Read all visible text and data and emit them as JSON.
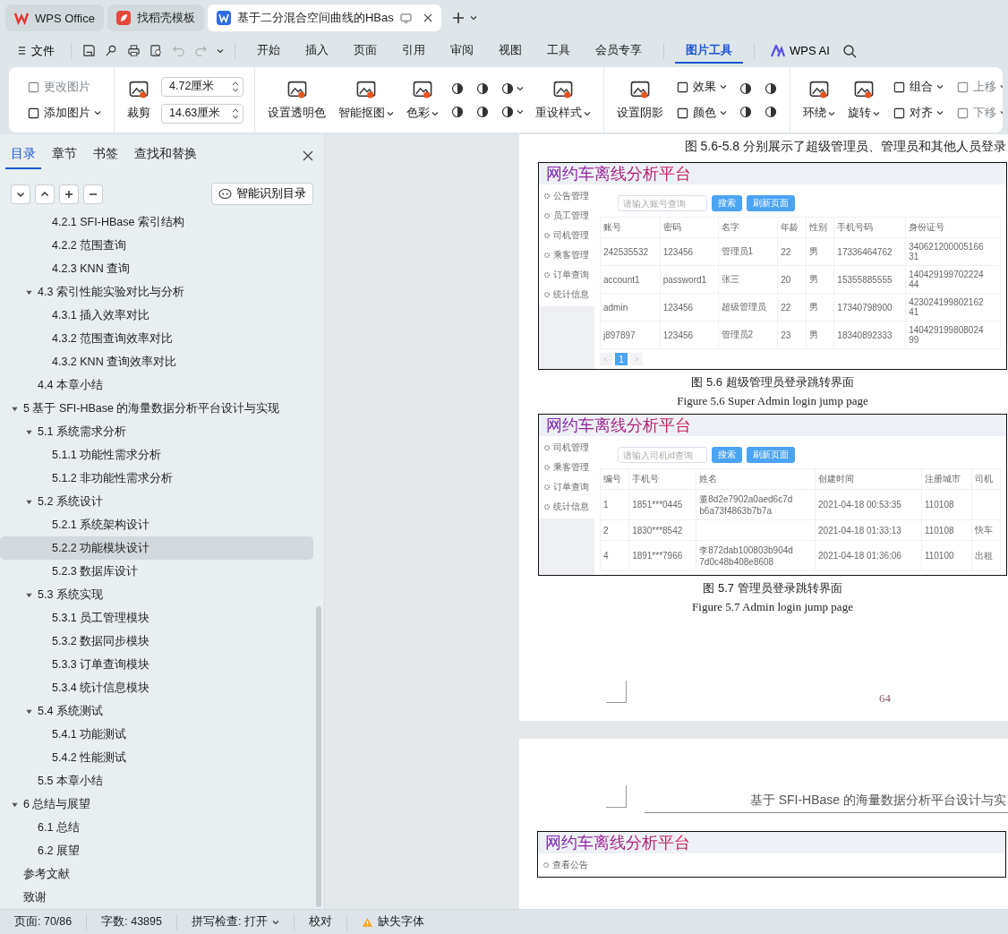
{
  "tabs": [
    {
      "kind": "home",
      "label": "WPS Office",
      "selected": false
    },
    {
      "kind": "template",
      "label": "找稻壳模板",
      "selected": false
    },
    {
      "kind": "document",
      "label": "基于二分混合空间曲线的HBas",
      "selected": true
    }
  ],
  "menu": {
    "file": "文件",
    "items": [
      {
        "label": "开始",
        "selected": false
      },
      {
        "label": "插入",
        "selected": false
      },
      {
        "label": "页面",
        "selected": false
      },
      {
        "label": "引用",
        "selected": false
      },
      {
        "label": "审阅",
        "selected": false
      },
      {
        "label": "视图",
        "selected": false
      },
      {
        "label": "工具",
        "selected": false
      },
      {
        "label": "会员专享",
        "selected": false
      },
      {
        "label": "图片工具",
        "selected": true
      }
    ],
    "ai": "WPS AI"
  },
  "ribbon": {
    "groups": [
      {
        "cols": [
          {
            "kind": "stack",
            "items": [
              {
                "kind": "small",
                "label": "更改图片",
                "dropdown": false,
                "disabled": true
              },
              {
                "kind": "small",
                "label": "添加图片",
                "dropdown": true,
                "disabled": false
              }
            ]
          }
        ]
      },
      {
        "cols": [
          {
            "kind": "big",
            "label": "裁剪",
            "dropdown": false
          },
          {
            "kind": "stack",
            "items": [
              {
                "kind": "field",
                "value": "4.72厘米"
              },
              {
                "kind": "field",
                "value": "14.63厘米"
              }
            ]
          }
        ]
      },
      {
        "cols": [
          {
            "kind": "big",
            "label": "设置透明色",
            "dropdown": false
          },
          {
            "kind": "big",
            "label": "智能抠图",
            "dropdown": true
          },
          {
            "kind": "big",
            "label": "色彩",
            "dropdown": true
          },
          {
            "kind": "stack",
            "items": [
              {
                "kind": "icon",
                "dropdown": false
              },
              {
                "kind": "icon",
                "dropdown": false
              }
            ]
          },
          {
            "kind": "stack",
            "items": [
              {
                "kind": "icon",
                "dropdown": false
              },
              {
                "kind": "icon",
                "dropdown": false
              }
            ]
          },
          {
            "kind": "stack",
            "items": [
              {
                "kind": "icon",
                "dropdown": true
              },
              {
                "kind": "icon",
                "dropdown": true
              }
            ]
          },
          {
            "kind": "big",
            "label": "重设样式",
            "dropdown": true
          }
        ]
      },
      {
        "cols": [
          {
            "kind": "big",
            "label": "设置阴影",
            "dropdown": false
          },
          {
            "kind": "stack",
            "items": [
              {
                "kind": "small",
                "label": "效果",
                "dropdown": true,
                "disabled": false
              },
              {
                "kind": "small",
                "label": "颜色",
                "dropdown": true,
                "disabled": false
              }
            ]
          },
          {
            "kind": "stack",
            "items": [
              {
                "kind": "icon",
                "dropdown": false
              },
              {
                "kind": "icon",
                "dropdown": false
              }
            ]
          },
          {
            "kind": "stack",
            "items": [
              {
                "kind": "icon",
                "dropdown": false
              },
              {
                "kind": "icon",
                "dropdown": false
              }
            ]
          }
        ]
      },
      {
        "cols": [
          {
            "kind": "big",
            "label": "环绕",
            "dropdown": true
          },
          {
            "kind": "big",
            "label": "旋转",
            "dropdown": true
          },
          {
            "kind": "stack",
            "items": [
              {
                "kind": "small",
                "label": "组合",
                "dropdown": true,
                "disabled": false
              },
              {
                "kind": "small",
                "label": "对齐",
                "dropdown": true,
                "disabled": false
              }
            ]
          },
          {
            "kind": "stack",
            "items": [
              {
                "kind": "small",
                "label": "上移",
                "dropdown": true,
                "disabled": true
              },
              {
                "kind": "small",
                "label": "下移",
                "dropdown": true,
                "disabled": true
              }
            ]
          }
        ]
      }
    ]
  },
  "nav": {
    "tabs": [
      {
        "label": "目录",
        "selected": true
      },
      {
        "label": "章节",
        "selected": false
      },
      {
        "label": "书签",
        "selected": false
      },
      {
        "label": "查找和替换",
        "selected": false
      }
    ],
    "smart_button": "智能识别目录",
    "toc": [
      {
        "children": [
          {
            "children": [
              {
                "label": "4.2.1 SFI-HBase 索引结构",
                "selected": false
              },
              {
                "label": "4.2.2 范围查询",
                "selected": false
              },
              {
                "label": "4.2.3 KNN 查询",
                "selected": false
              }
            ]
          },
          {
            "label": "4.3 索引性能实验对比与分析",
            "selected": false,
            "expanded": true,
            "children": [
              {
                "label": "4.3.1 插入效率对比",
                "selected": false
              },
              {
                "label": "4.3.2 范围查询效率对比",
                "selected": false
              },
              {
                "label": "4.3.2 KNN 查询效率对比",
                "selected": false
              }
            ]
          },
          {
            "label": "4.4 本章小结",
            "selected": false
          }
        ]
      },
      {
        "label": "5 基于 SFI-HBase 的海量数据分析平台设计与实现",
        "selected": false,
        "expanded": true,
        "children": [
          {
            "label": "5.1 系统需求分析",
            "selected": false,
            "expanded": true,
            "children": [
              {
                "label": "5.1.1 功能性需求分析",
                "selected": false
              },
              {
                "label": "5.1.2 非功能性需求分析",
                "selected": false
              }
            ]
          },
          {
            "label": "5.2 系统设计",
            "selected": false,
            "expanded": true,
            "children": [
              {
                "label": "5.2.1 系统架构设计",
                "selected": false
              },
              {
                "label": "5.2.2 功能模块设计",
                "selected": true
              },
              {
                "label": "5.2.3 数据库设计",
                "selected": false
              }
            ]
          },
          {
            "label": "5.3 系统实现",
            "selected": false,
            "expanded": true,
            "children": [
              {
                "label": "5.3.1 员工管理模块",
                "selected": false
              },
              {
                "label": "5.3.2 数据同步模块",
                "selected": false
              },
              {
                "label": "5.3.3 订单查询模块",
                "selected": false
              },
              {
                "label": "5.3.4 统计信息模块",
                "selected": false
              }
            ]
          },
          {
            "label": "5.4 系统测试",
            "selected": false,
            "expanded": true,
            "children": [
              {
                "label": "5.4.1 功能测试",
                "selected": false
              },
              {
                "label": "5.4.2 性能测试",
                "selected": false
              }
            ]
          },
          {
            "label": "5.5 本章小结",
            "selected": false
          }
        ]
      },
      {
        "label": "6 总结与展望",
        "selected": false,
        "expanded": true,
        "children": [
          {
            "label": "6.1 总结",
            "selected": false
          },
          {
            "label": "6.2 展望",
            "selected": false
          }
        ]
      },
      {
        "label": "参考文献",
        "selected": false
      },
      {
        "label": "致谢",
        "selected": false
      }
    ]
  },
  "document": {
    "pages": [
      {
        "number": "64",
        "blocks": [
          {
            "kind": "paragraph",
            "text": "图 5.6-5.8 分别展示了超级管理员、管理员和其他人员登录"
          },
          {
            "kind": "figure",
            "app": {
              "title": "网约车离线分析平台",
              "menu": [
                "公告管理",
                "员工管理",
                "司机管理",
                "乘客管理",
                "订单查询",
                "统计信息"
              ],
              "search": {
                "placeholder": "请输入账号查询"
              },
              "buttons": [
                "搜索",
                "刷新页面"
              ],
              "columns": [
                "账号",
                "密码",
                "名字",
                "年龄",
                "性别",
                "手机号码",
                "身份证号"
              ],
              "rows": [
                [
                  "242535532",
                  "123456",
                  "管理员1",
                  "22",
                  "男",
                  "17336464762",
                  "340621200005166\n31"
                ],
                [
                  "account1",
                  "password1",
                  "张三",
                  "20",
                  "男",
                  "15355885555",
                  "140429199702224\n44"
                ],
                [
                  "admin",
                  "123456",
                  "超级管理员",
                  "22",
                  "男",
                  "17340798900",
                  "423024199802162\n41"
                ],
                [
                  "j897897",
                  "123456",
                  "管理员2",
                  "23",
                  "男",
                  "18340892333",
                  "140429199808024\n99"
                ]
              ],
              "pager": [
                {
                  "label": "1",
                  "selected": true
                }
              ]
            }
          },
          {
            "kind": "caption",
            "text": "图 5.6 超级管理员登录跳转界面"
          },
          {
            "kind": "caption_en",
            "text": "Figure 5.6 Super Admin login jump page"
          },
          {
            "kind": "figure",
            "app": {
              "title": "网约车离线分析平台",
              "menu": [
                "司机管理",
                "乘客管理",
                "订单查询",
                "统计信息"
              ],
              "search": {
                "placeholder": "请输入司机id查询"
              },
              "buttons": [
                "搜索",
                "刷新页面"
              ],
              "columns": [
                "编号",
                "手机号",
                "姓名",
                "创建时间",
                "注册城市",
                "司机"
              ],
              "rows": [
                [
                  "1",
                  "1851***0445",
                  "董8d2e7902a0aed6c7d\nb6a73f4863b7b7a",
                  "2021-04-18 00:53:35",
                  "110108",
                  ""
                ],
                [
                  "2",
                  "1830***8542",
                  "",
                  "2021-04-18 01:33:13",
                  "110108",
                  "快车"
                ],
                [
                  "4",
                  "1891***7966",
                  "李872dab100803b904d\n7d0c48b408e8608",
                  "2021-04-18 01:36:06",
                  "110100",
                  "出租"
                ]
              ]
            }
          },
          {
            "kind": "caption",
            "text": "图 5.7 管理员登录跳转界面"
          },
          {
            "kind": "caption_en",
            "text": "Figure 5.7 Admin login jump page"
          }
        ]
      },
      {
        "header": "基于 SFI-HBase 的海量数据分析平台设计与实",
        "blocks": [
          {
            "kind": "figure",
            "app": {
              "title": "网约车离线分析平台",
              "menu": [
                "查看公告"
              ]
            }
          }
        ]
      }
    ]
  },
  "status_bar": {
    "page": "页面: 70/86",
    "words": "字数: 43895",
    "spell": "拼写检查: 打开",
    "proof": "校对",
    "missing_fonts": "缺失字体"
  }
}
